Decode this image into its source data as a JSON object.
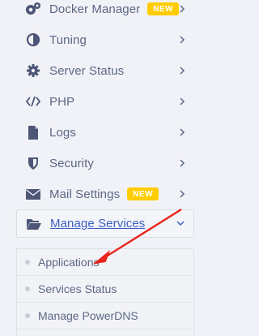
{
  "menu": {
    "items": [
      {
        "label": "Docker Manager",
        "icon": "docker-gear-icon",
        "badge": "NEW"
      },
      {
        "label": "Tuning",
        "icon": "half-circle-icon"
      },
      {
        "label": "Server Status",
        "icon": "gear-icon"
      },
      {
        "label": "PHP",
        "icon": "code-icon"
      },
      {
        "label": "Logs",
        "icon": "file-icon"
      },
      {
        "label": "Security",
        "icon": "shield-icon"
      },
      {
        "label": "Mail Settings",
        "icon": "envelope-icon",
        "badge": "NEW"
      },
      {
        "label": "Manage Services",
        "icon": "folder-open-icon",
        "expanded": true
      }
    ],
    "submenu": [
      {
        "label": "Applications"
      },
      {
        "label": "Services Status"
      },
      {
        "label": "Manage PowerDNS"
      }
    ]
  },
  "colors": {
    "text": "#5c6785",
    "link": "#3b5fc4",
    "badge": "#ffcc00",
    "annotation_arrow": "#e8231c"
  }
}
